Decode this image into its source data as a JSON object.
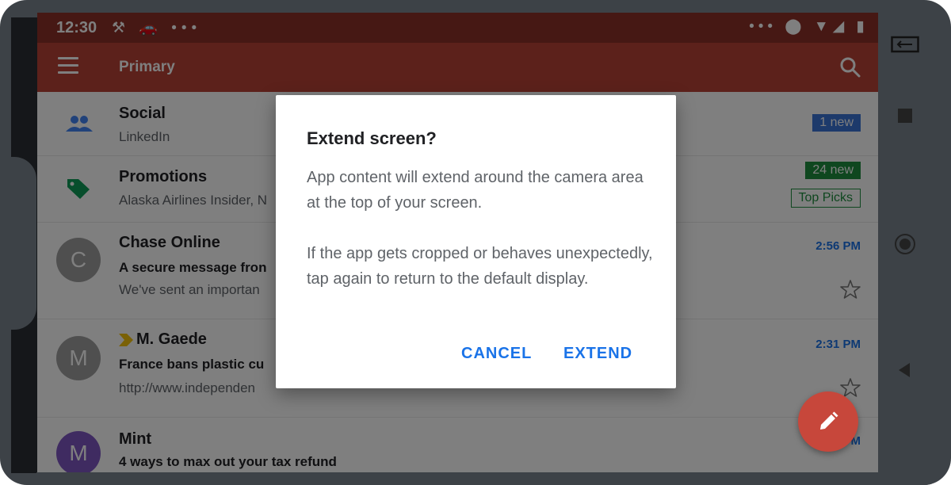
{
  "status_bar": {
    "time": "12:30",
    "left_icons": "⚒ 🚗 •••",
    "right_icons": "••• ⬤ ▼◢ ▮"
  },
  "app_bar": {
    "title": "Primary"
  },
  "inbox": {
    "social": {
      "title": "Social",
      "snippet": "LinkedIn",
      "badge": "1 new",
      "badge_color": "#3a74d6"
    },
    "promotions": {
      "title": "Promotions",
      "snippet": "Alaska Airlines Insider, N",
      "badge": "24 new",
      "badge_color": "#1e8e3e",
      "tag": "Top Picks"
    },
    "emails": [
      {
        "avatar": "C",
        "avatar_color": "#9e9e9e",
        "sender": "Chase Online",
        "subject": "A secure message fron",
        "snippet": "We've sent an importan",
        "time": "2:56 PM"
      },
      {
        "avatar": "M",
        "avatar_color": "#9e9e9e",
        "sender": "M. Gaede",
        "subject": "France bans plastic cu",
        "snippet": "http://www.independen",
        "time": "2:31 PM"
      },
      {
        "avatar": "M",
        "avatar_color": "#7e57c2",
        "sender": "Mint",
        "subject": "4 ways to max out your tax refund",
        "snippet": "",
        "time": "PM"
      }
    ]
  },
  "dialog": {
    "title": "Extend screen?",
    "body1": "App content will extend around the camera area at the top of your screen.",
    "body2": "If the app gets cropped or behaves unexpectedly, tap again to return to the default display.",
    "cancel": "CANCEL",
    "extend": "EXTEND"
  },
  "colors": {
    "status_bar": "#8c3028",
    "app_bar": "#b84337",
    "accent": "#1a73e8",
    "fab": "#c7473b"
  },
  "icons": [
    "menu-icon",
    "search-icon",
    "people-icon",
    "tag-icon",
    "star-icon",
    "pencil-icon",
    "importance-marker-icon",
    "resize-icon",
    "square-icon",
    "circle-icon",
    "back-icon"
  ]
}
